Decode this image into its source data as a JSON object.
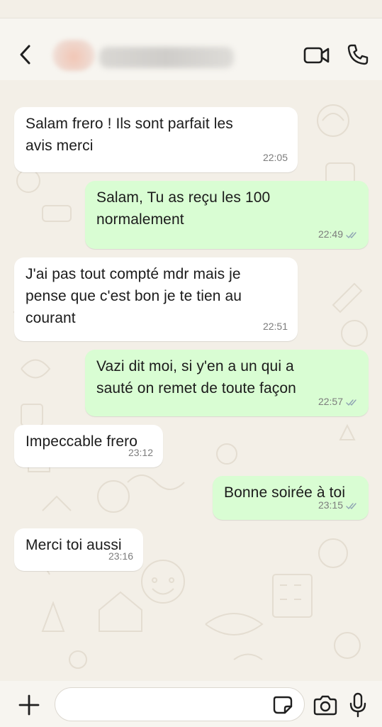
{
  "header": {
    "contact_name": "",
    "back_icon": "chevron-left-icon",
    "video_icon": "video-camera-icon",
    "call_icon": "phone-icon"
  },
  "messages": [
    {
      "direction": "in",
      "text": "Salam frero ! Ils sont parfait les\navis merci",
      "time": "22:05"
    },
    {
      "direction": "out",
      "text": "Salam, Tu as reçu les 100\nnormalement",
      "time": "22:49",
      "status": "read"
    },
    {
      "direction": "in",
      "text": "J'ai pas tout compté mdr mais je\npense que c'est bon je te tien au\ncourant",
      "time": "22:51"
    },
    {
      "direction": "out",
      "text": "Vazi dit moi, si y'en a un qui a\nsauté on remet de toute façon",
      "time": "22:57",
      "status": "read"
    },
    {
      "direction": "in",
      "text": "Impeccable frero",
      "time": "23:12"
    },
    {
      "direction": "out",
      "text": "Bonne soirée à toi",
      "time": "23:15",
      "status": "read"
    },
    {
      "direction": "in",
      "text": "Merci toi aussi",
      "time": "23:16"
    }
  ],
  "composer": {
    "placeholder": "",
    "plus_icon": "plus-icon",
    "sticker_icon": "sticker-icon",
    "camera_icon": "camera-icon",
    "mic_icon": "microphone-icon"
  },
  "colors": {
    "incoming_bubble": "#ffffff",
    "outgoing_bubble": "#d9fdd3",
    "wallpaper": "#f3efe7",
    "read_ticks": "#8fa3b3"
  }
}
